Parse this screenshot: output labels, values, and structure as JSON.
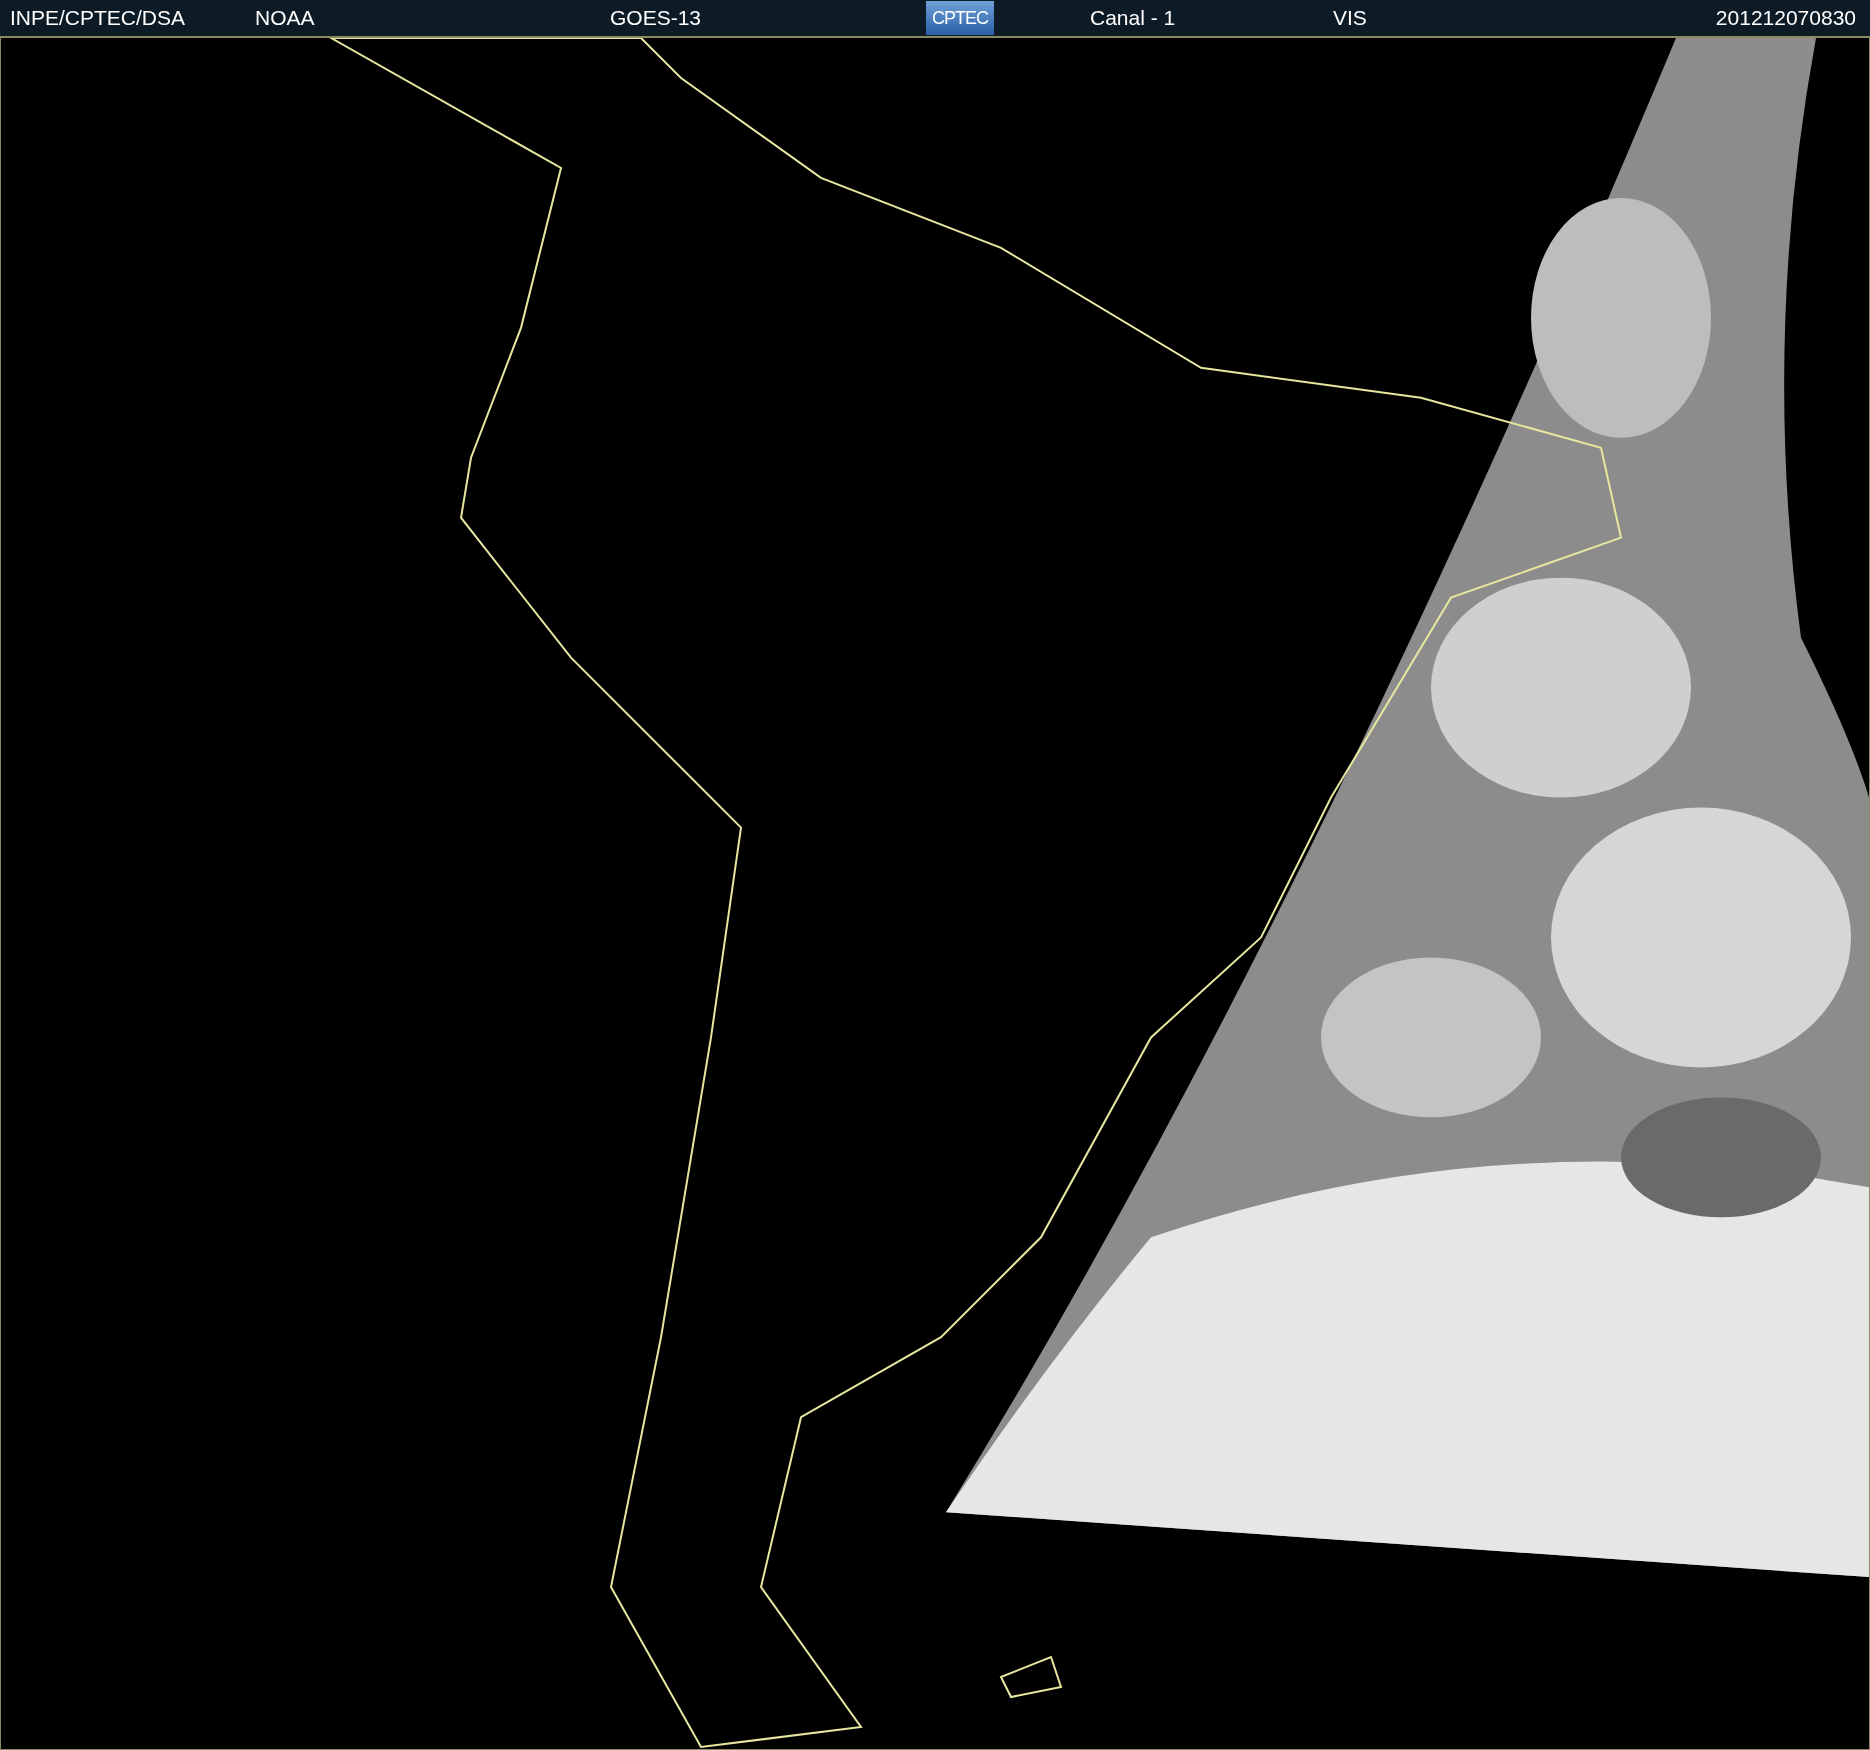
{
  "header": {
    "agency": "INPE/CPTEC/DSA",
    "source": "NOAA",
    "satellite": "GOES-13",
    "logo": "CPTEC",
    "channel": "Canal - 1",
    "band": "VIS",
    "timestamp": "201212070830"
  }
}
